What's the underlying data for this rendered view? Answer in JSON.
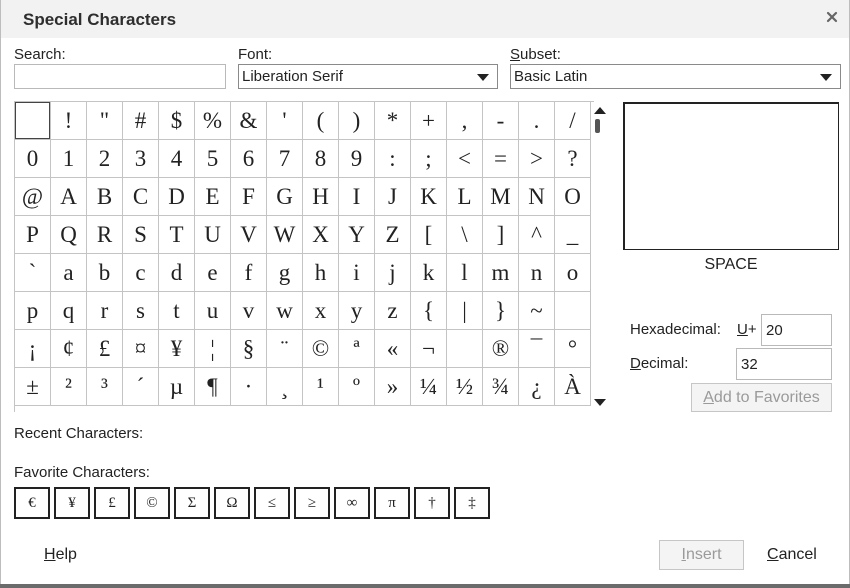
{
  "dialog": {
    "title": "Special Characters",
    "close_icon": "close-icon"
  },
  "search": {
    "label": "Search:",
    "value": "",
    "placeholder": ""
  },
  "font": {
    "label": "Font:",
    "value": "Liberation Serif"
  },
  "subset": {
    "label_first": "S",
    "label_rest": "ubset:",
    "value": "Basic Latin"
  },
  "grid": {
    "cells": [
      " ",
      "!",
      "\"",
      "#",
      "$",
      "%",
      "&",
      "'",
      "(",
      ")",
      "*",
      "+",
      ",",
      "-",
      ".",
      "/",
      "0",
      "1",
      "2",
      "3",
      "4",
      "5",
      "6",
      "7",
      "8",
      "9",
      ":",
      ";",
      "<",
      "=",
      ">",
      "?",
      "@",
      "A",
      "B",
      "C",
      "D",
      "E",
      "F",
      "G",
      "H",
      "I",
      "J",
      "K",
      "L",
      "M",
      "N",
      "O",
      "P",
      "Q",
      "R",
      "S",
      "T",
      "U",
      "V",
      "W",
      "X",
      "Y",
      "Z",
      "[",
      "\\",
      "]",
      "^",
      "_",
      "`",
      "a",
      "b",
      "c",
      "d",
      "e",
      "f",
      "g",
      "h",
      "i",
      "j",
      "k",
      "l",
      "m",
      "n",
      "o",
      "p",
      "q",
      "r",
      "s",
      "t",
      "u",
      "v",
      "w",
      "x",
      "y",
      "z",
      "{",
      "|",
      "}",
      "~",
      " ",
      "¡",
      "¢",
      "£",
      "¤",
      "¥",
      "¦",
      "§",
      "¨",
      "©",
      "ª",
      "«",
      "¬",
      " ",
      "®",
      "¯",
      "°",
      "±",
      "²",
      "³",
      "´",
      "µ",
      "¶",
      "·",
      "¸",
      "¹",
      "º",
      "»",
      "¼",
      "½",
      "¾",
      "¿",
      "À"
    ],
    "selected_index": 0
  },
  "preview": {
    "char_name": "SPACE"
  },
  "hexadecimal": {
    "label_prefix": "Hexadecimal:",
    "u_label": "U",
    "plus": "+",
    "value": "20"
  },
  "decimal": {
    "label_first": "D",
    "label_rest": "ecimal:",
    "value": "32"
  },
  "add_favorites": {
    "first": "A",
    "rest": "dd to Favorites"
  },
  "recent": {
    "label": "Recent Characters:"
  },
  "favorites": {
    "label": "Favorite Characters:",
    "items": [
      "€",
      "¥",
      "£",
      "©",
      "Σ",
      "Ω",
      "≤",
      "≥",
      "∞",
      "π",
      "†",
      "‡"
    ]
  },
  "buttons": {
    "help_first": "H",
    "help_rest": "elp",
    "insert_first": "I",
    "insert_rest": "nsert",
    "cancel_first": "C",
    "cancel_rest": "ancel"
  }
}
